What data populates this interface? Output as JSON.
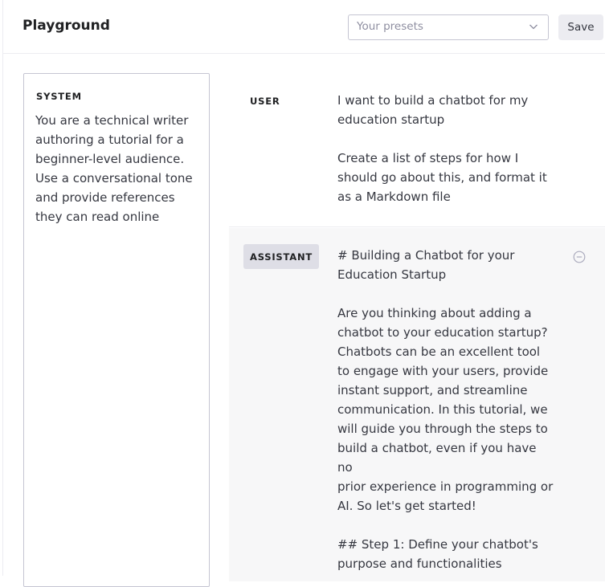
{
  "header": {
    "title": "Playground",
    "presets_placeholder": "Your presets",
    "save_label": "Save"
  },
  "system": {
    "label": "SYSTEM",
    "text": "You are a technical writer\nauthoring a tutorial for a\nbeginner-level audience.\nUse a conversational tone\nand provide references\nthey can read online"
  },
  "messages": [
    {
      "role": "USER",
      "text": "I want to build a chatbot for my\neducation startup\n\nCreate a list of steps for how I\nshould go about this, and format it\nas a Markdown file"
    },
    {
      "role": "ASSISTANT",
      "text": "# Building a Chatbot for your\nEducation Startup\n\nAre you thinking about adding a\nchatbot to your education startup?\nChatbots can be an excellent tool\nto engage with your users, provide\ninstant support, and streamline\ncommunication. In this tutorial, we\nwill guide you through the steps to\nbuild a chatbot, even if you have no\nprior experience in programming or\nAI. So let's get started!\n\n## Step 1: Define your chatbot's\npurpose and functionalities"
    }
  ],
  "icons": {
    "presets_chevron": "chevron-down-icon",
    "remove_message": "minus-circle-icon"
  },
  "colors": {
    "assistant_bg": "#f7f7f8",
    "role_badge_bg": "#dedee6",
    "save_bg": "#ececf1"
  }
}
